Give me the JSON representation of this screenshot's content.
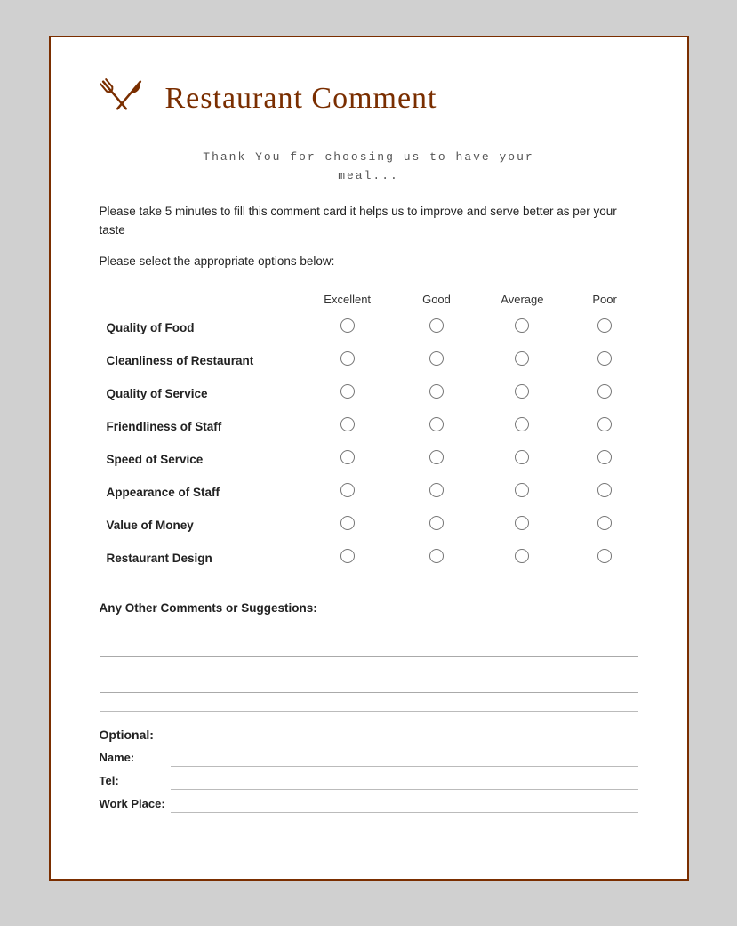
{
  "header": {
    "title": "Restaurant Comment",
    "icon": "🍴"
  },
  "thank_you": {
    "line1": "Thank You for choosing us to have your",
    "line2": "meal..."
  },
  "description": "Please take 5 minutes to fill this comment card it helps us to improve and serve better as per your taste",
  "instruction": "Please select the appropriate options below:",
  "table": {
    "headers": [
      "",
      "Excellent",
      "Good",
      "Average",
      "Poor"
    ],
    "rows": [
      "Quality of Food",
      "Cleanliness of Restaurant",
      "Quality of Service",
      "Friendliness of Staff",
      "Speed of Service",
      "Appearance of Staff",
      "Value of Money",
      "Restaurant Design"
    ]
  },
  "comments": {
    "label": "Any Other Comments or Suggestions:"
  },
  "optional": {
    "title": "Optional:",
    "fields": [
      "Name:",
      "Tel:",
      "Work Place:"
    ]
  }
}
